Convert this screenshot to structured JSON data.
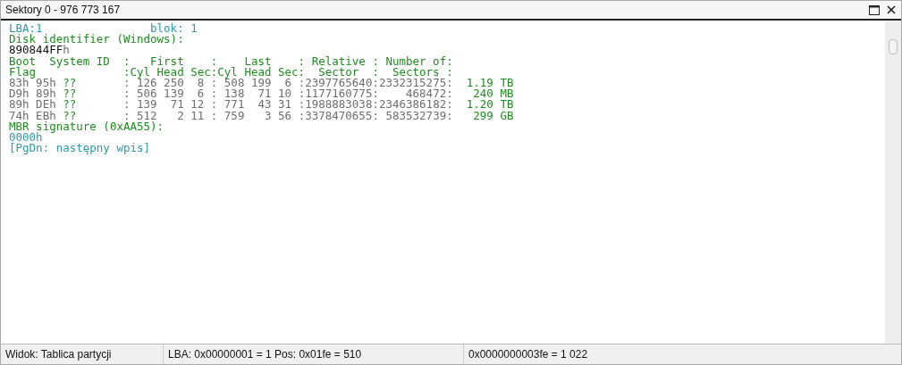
{
  "window": {
    "title": "Sektory 0 - 976 773 167"
  },
  "lines": [
    {
      "segments": [
        {
          "text": "LBA:1                blok: 1",
          "kind": "teal"
        }
      ]
    },
    {
      "segments": [
        {
          "text": "Disk identifier (Windows):",
          "kind": "green"
        }
      ]
    },
    {
      "segments": [
        {
          "text": "890844FF",
          "kind": "black"
        },
        {
          "text": "h",
          "kind": "grey"
        }
      ]
    },
    {
      "segments": [
        {
          "text": "Boot  System ID  :   First    :    Last    : Relative : Number of:",
          "kind": "green"
        }
      ]
    },
    {
      "segments": [
        {
          "text": "Flag             :Cyl Head Sec:Cyl Head Sec:  Sector  :  Sectors :",
          "kind": "green"
        }
      ]
    },
    {
      "segments": [
        {
          "text": "83h 95h ",
          "kind": "grey"
        },
        {
          "text": "??",
          "kind": "green"
        },
        {
          "text": "       : 126 250  8 : 508 199  6 :2397765640:2332315275:  ",
          "kind": "grey"
        },
        {
          "text": "1.19 TB",
          "kind": "green"
        }
      ]
    },
    {
      "segments": [
        {
          "text": "D9h 89h ",
          "kind": "grey"
        },
        {
          "text": "??",
          "kind": "green"
        },
        {
          "text": "       : 506 139  6 : 138  71 10 :1177160775:    468472:   ",
          "kind": "grey"
        },
        {
          "text": "240 MB",
          "kind": "green"
        }
      ]
    },
    {
      "segments": [
        {
          "text": "89h DEh ",
          "kind": "grey"
        },
        {
          "text": "??",
          "kind": "green"
        },
        {
          "text": "       : 139  71 12 : 771  43 31 :1988883038:2346386182:  ",
          "kind": "grey"
        },
        {
          "text": "1.20 TB",
          "kind": "green"
        }
      ]
    },
    {
      "segments": [
        {
          "text": "74h EBh ",
          "kind": "grey"
        },
        {
          "text": "??",
          "kind": "green"
        },
        {
          "text": "       : 512   2 11 : 759   3 56 :3378470655: 583532739:   ",
          "kind": "grey"
        },
        {
          "text": "299 GB",
          "kind": "green"
        }
      ]
    },
    {
      "segments": [
        {
          "text": "MBR signature (0xAA55):",
          "kind": "green"
        }
      ]
    },
    {
      "segments": [
        {
          "text": "0000h",
          "kind": "teal"
        }
      ]
    },
    {
      "segments": [
        {
          "text": "[PgDn: następny wpis]",
          "kind": "teal"
        }
      ]
    }
  ],
  "status_bar": [
    "Widok: Tablica partycji",
    "LBA: 0x00000001 = 1  Pos: 0x01fe = 510",
    "0x0000000003fe = 1 022"
  ]
}
